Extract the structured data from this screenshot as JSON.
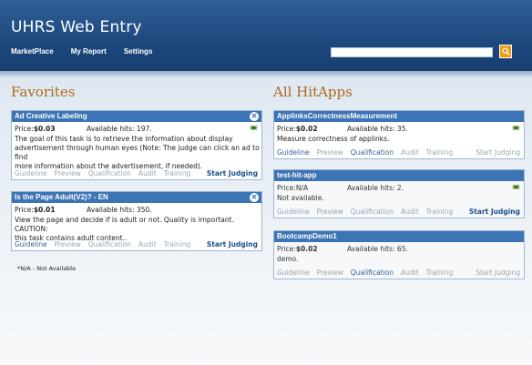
{
  "app_title": "UHRS Web Entry",
  "nav": [
    "MarketPlace",
    "My Report",
    "Settings"
  ],
  "search": {
    "placeholder": ""
  },
  "favorites": {
    "title": "Favorites",
    "cards": [
      {
        "title": "Ad Creative Labeling",
        "price_label": "Price:",
        "price": "$0.03",
        "hits": "Available hits: 197.",
        "desc": [
          "The goal of this task is to retrieve the information about display",
          "advertisement through human eyes (Note: The judge can click an ad to find",
          "more information about the advertisement, if needed)."
        ],
        "links": [
          "Guideline",
          "Preview",
          "Qualification",
          "Audit",
          "Training"
        ],
        "start": "Start Judging"
      },
      {
        "title": "Is the Page Adult(V2)? - EN",
        "price_label": "Price:",
        "price": "$0.01",
        "hits": "Available hits: 350.",
        "desc": [
          "View the page and decide if is adult or not. Quality is important. CAUTION:",
          "this task contains adult content.."
        ],
        "links": [
          "Guideline",
          "Preview",
          "Qualification",
          "Audit",
          "Training"
        ],
        "start": "Start Judging"
      }
    ],
    "footnote": "*N/A - Not Available"
  },
  "hitapps": {
    "title": "All HitApps",
    "cards": [
      {
        "title": "ApplinksCorrectnessMeasurement",
        "price_label": "Price:",
        "price": "$0.02",
        "hits": "Available hits: 35.",
        "desc": [
          "Measure correctness of applinks."
        ],
        "links": [
          "Guideline",
          "Preview",
          "Qualification",
          "Audit",
          "Training"
        ],
        "start": "Start Judging"
      },
      {
        "title": "test-hit-app",
        "price_label": "Price:",
        "price": "N/A",
        "hits": "Available hits: 2.",
        "desc": [
          "Not available."
        ],
        "links": [
          "Guideline",
          "Preview",
          "Qualification",
          "Audit",
          "Training"
        ],
        "start": "Start Judging"
      },
      {
        "title": "BootcampDemo1",
        "price_label": "Price:",
        "price": "$0.02",
        "hits": "Available hits: 65.",
        "desc": [
          "demo."
        ],
        "links": [
          "Guideline",
          "Preview",
          "Qualification",
          "Audit",
          "Training"
        ],
        "start": "Start Judging"
      }
    ]
  }
}
